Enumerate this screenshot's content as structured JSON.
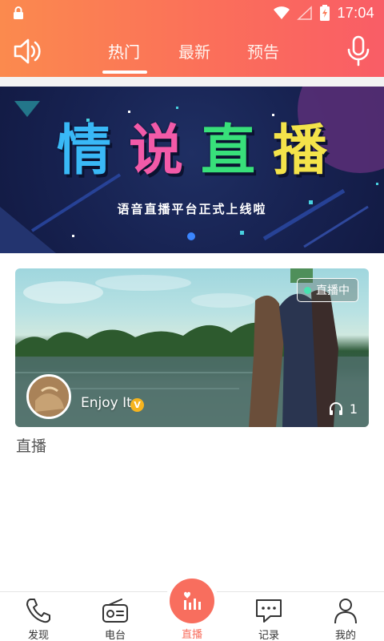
{
  "status_bar": {
    "time": "17:04",
    "icons": [
      "lock-icon",
      "wifi-icon",
      "signal-icon",
      "battery-charging-icon"
    ]
  },
  "top_nav": {
    "tabs": [
      {
        "label": "热门",
        "active": true
      },
      {
        "label": "最新",
        "active": false
      },
      {
        "label": "预告",
        "active": false
      }
    ],
    "left_icon": "speaker-icon",
    "right_icon": "microphone-icon"
  },
  "banner": {
    "title_chars": [
      "情",
      "说",
      "直",
      "播"
    ],
    "title_colors": [
      "#39b8f6",
      "#f25aa8",
      "#38e07a",
      "#f4e34a"
    ],
    "subtitle": "语音直播平台正式上线啦",
    "page_indicator": {
      "count": 1,
      "active": 0
    }
  },
  "live_card": {
    "badge": "直播中",
    "username": "Enjoy It",
    "verified_badge": "V",
    "listeners": "1"
  },
  "section_label": "直播",
  "bottom_tabs": [
    {
      "label": "发现",
      "icon": "phone-icon",
      "active": false
    },
    {
      "label": "电台",
      "icon": "radio-icon",
      "active": false
    },
    {
      "label": "直播",
      "icon": "live-bars-icon",
      "active": true
    },
    {
      "label": "记录",
      "icon": "message-icon",
      "active": false
    },
    {
      "label": "我的",
      "icon": "person-icon",
      "active": false
    }
  ],
  "colors": {
    "header_start": "#fb8a4e",
    "header_end": "#f95d66",
    "accent": "#f86e5e",
    "live_dot": "#47e3b0",
    "verified": "#f6b41e"
  }
}
